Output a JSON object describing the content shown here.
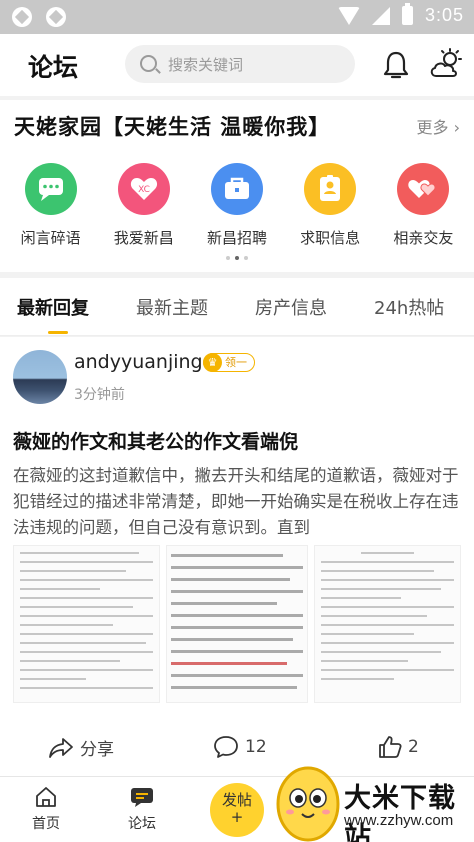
{
  "status_bar": {
    "time": "3:05"
  },
  "header": {
    "title": "论坛",
    "search_placeholder": "搜索关键词"
  },
  "community": {
    "title": "天姥家园【天姥生活 温暖你我】",
    "more_label": "更多",
    "shortcuts": [
      {
        "label": "闲言碎语",
        "icon": "chat-bubble-icon",
        "color": "#3cc46f"
      },
      {
        "label": "我爱新昌",
        "icon": "heart-icon",
        "color": "#f3557c"
      },
      {
        "label": "新昌招聘",
        "icon": "briefcase-icon",
        "color": "#4b8ff0"
      },
      {
        "label": "求职信息",
        "icon": "id-card-icon",
        "color": "#fbbf24"
      },
      {
        "label": "相亲交友",
        "icon": "hearts-icon",
        "color": "#f25c5c"
      }
    ]
  },
  "tabs": [
    {
      "label": "最新回复",
      "active": true
    },
    {
      "label": "最新主题",
      "active": false
    },
    {
      "label": "房产信息",
      "active": false
    },
    {
      "label": "24h热帖",
      "active": false
    }
  ],
  "post": {
    "username": "andyyuanjing",
    "level": "领一",
    "time": "3分钟前",
    "title": "薇娅的作文和其老公的作文看端倪",
    "excerpt": "在薇娅的这封道歉信中，撇去开头和结尾的道歉语，薇娅对于犯错经过的描述非常清楚，即她一开始确实是在税收上存在违法违规的问题，但自己没有意识到。直到",
    "share_label": "分享",
    "comment_count": "12",
    "like_count": "2"
  },
  "bottom_nav": {
    "home_label": "首页",
    "forum_label": "论坛",
    "post_label": "发帖",
    "post_plus": "+"
  },
  "watermark": {
    "title": "大米下载站",
    "url": "www.zzhyw.com"
  }
}
